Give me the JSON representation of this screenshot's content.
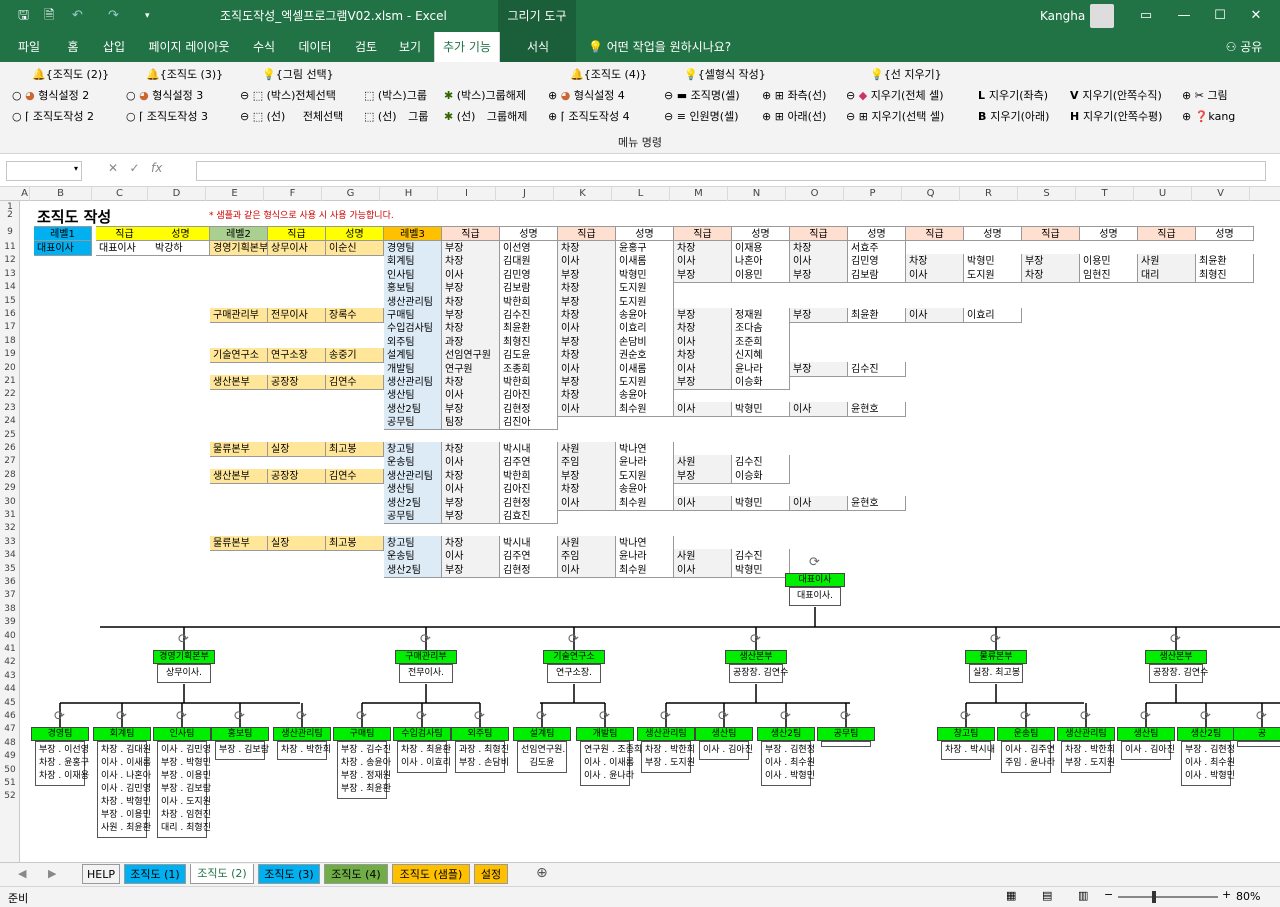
{
  "window": {
    "title": "조직도작성_엑셀프로그램V02.xlsm - Excel",
    "context_tool": "그리기 도구",
    "user": "Kangha"
  },
  "tabs": [
    "파일",
    "홈",
    "삽입",
    "페이지 레이아웃",
    "수식",
    "데이터",
    "검토",
    "보기",
    "추가 기능",
    "서식"
  ],
  "tell_me": "어떤 작업을 원하시나요?",
  "share": "공유",
  "ribbon": {
    "row1": [
      "{조직도 (2)}",
      "{조직도 (3)}",
      "{그림 선택}",
      "{조직도 (4)}",
      "{셀형식 작성}",
      "{선 지우기}"
    ],
    "row2": [
      "형식설정 2",
      "형식설정 3",
      "(박스)전체선택",
      "(박스)그룹",
      "(박스)그룹해제",
      "형식설정 4",
      "조직명(셀)",
      "좌측(선)",
      "지우기(전체 셀)",
      "지우기(좌측)",
      "지우기(안쪽수직)",
      "그림"
    ],
    "row3": [
      "조직도작성 2",
      "조직도작성 3",
      "(선)",
      "전체선택",
      "(선)",
      "그룹",
      "(선)",
      "그룹해제",
      "조직도작성 4",
      "인원명(셀)",
      "아래(선)",
      "지우기(선택 셀)",
      "지우기(아래)",
      "지우기(안쪽수평)",
      "kang"
    ],
    "group_label": "메뉴 명령"
  },
  "formula": {
    "fx": "fx",
    "value": ""
  },
  "columns": [
    "A",
    "B",
    "C",
    "D",
    "E",
    "F",
    "G",
    "H",
    "I",
    "J",
    "K",
    "L",
    "M",
    "N",
    "O",
    "P",
    "Q",
    "R",
    "S",
    "T",
    "U",
    "V"
  ],
  "rows": [
    "1",
    "2",
    "9",
    "11",
    "12",
    "13",
    "14",
    "15",
    "16",
    "17",
    "18",
    "19",
    "20",
    "21",
    "22",
    "23",
    "24",
    "25",
    "26",
    "27",
    "28",
    "29",
    "30",
    "31",
    "32",
    "33",
    "34",
    "35",
    "36",
    "37",
    "38",
    "39",
    "40",
    "41",
    "42",
    "43",
    "44",
    "45",
    "46",
    "47",
    "48",
    "49",
    "50",
    "51",
    "52"
  ],
  "sheet": {
    "title": "조직도 작성",
    "note": "* 샘플과 같은 형식으로 사용 시 사용 가능합니다.",
    "headers": [
      "레벨1",
      "직급",
      "성명",
      "레벨2",
      "직급",
      "성명",
      "레벨3",
      "직급",
      "성명",
      "직급",
      "성명",
      "직급",
      "성명",
      "직급",
      "성명",
      "직급",
      "성명",
      "직급",
      "성명",
      "직급",
      "성명"
    ],
    "level1": [
      "대표이사",
      "대표이사",
      "박강하"
    ],
    "level2": [
      {
        "row": 11,
        "v": [
          "경영기획본부",
          "상무이사",
          "이순신"
        ]
      },
      {
        "row": 16,
        "v": [
          "구매관리부",
          "전무이사",
          "장록수"
        ]
      },
      {
        "row": 19,
        "v": [
          "기술연구소",
          "연구소장",
          "송중기"
        ]
      },
      {
        "row": 21,
        "v": [
          "생산본부",
          "공장장",
          "김연수"
        ]
      },
      {
        "row": 26,
        "v": [
          "물류본부",
          "실장",
          "최고봉"
        ]
      },
      {
        "row": 28,
        "v": [
          "생산본부",
          "공장장",
          "김연수"
        ]
      },
      {
        "row": 33,
        "v": [
          "물류본부",
          "실장",
          "최고봉"
        ]
      }
    ],
    "level3": [
      {
        "row": 11,
        "v": [
          "경영팀",
          "부장",
          "이선영",
          "차장",
          "윤홍구",
          "차장",
          "이재용",
          "차장",
          "서효주"
        ]
      },
      {
        "row": 12,
        "v": [
          "회계팀",
          "차장",
          "김대원",
          "이사",
          "이새롬",
          "이사",
          "나혼아",
          "이사",
          "김민영",
          "차장",
          "박형민",
          "부장",
          "이용민",
          "사원",
          "최윤환"
        ]
      },
      {
        "row": 13,
        "v": [
          "인사팀",
          "이사",
          "김민영",
          "부장",
          "박형민",
          "부장",
          "이용민",
          "부장",
          "김보람",
          "이사",
          "도지원",
          "차장",
          "임현진",
          "대리",
          "최형진"
        ]
      },
      {
        "row": 14,
        "v": [
          "홍보팀",
          "부장",
          "김보람",
          "차장",
          "도지원"
        ]
      },
      {
        "row": 15,
        "v": [
          "생산관리팀",
          "차장",
          "박한희",
          "부장",
          "도지원"
        ]
      },
      {
        "row": 16,
        "v": [
          "구매팀",
          "부장",
          "김수진",
          "차장",
          "송윤아",
          "부장",
          "정재원",
          "부장",
          "최윤환",
          "이사",
          "이효리"
        ]
      },
      {
        "row": 17,
        "v": [
          "수입검사팀",
          "차장",
          "최윤환",
          "이사",
          "이효리",
          "차장",
          "조다솜"
        ]
      },
      {
        "row": 18,
        "v": [
          "외주팀",
          "과장",
          "최형진",
          "부장",
          "손담비",
          "이사",
          "조준희"
        ]
      },
      {
        "row": 19,
        "v": [
          "설계팀",
          "선임연구원",
          "김도윤",
          "차장",
          "권순호",
          "차장",
          "신지혜"
        ]
      },
      {
        "row": 20,
        "v": [
          "개발팀",
          "연구원",
          "조종희",
          "이사",
          "이새롬",
          "이사",
          "윤나라",
          "부장",
          "김수진"
        ]
      },
      {
        "row": 21,
        "v": [
          "생산관리팀",
          "차장",
          "박한희",
          "부장",
          "도지원",
          "부장",
          "이승화"
        ]
      },
      {
        "row": 22,
        "v": [
          "생산팀",
          "이사",
          "김아진",
          "차장",
          "송윤아"
        ]
      },
      {
        "row": 23,
        "v": [
          "생산2팀",
          "부장",
          "김현정",
          "이사",
          "최수원",
          "이사",
          "박형민",
          "이사",
          "윤현호"
        ]
      },
      {
        "row": 24,
        "v": [
          "공무팀",
          "팀장",
          "김진아"
        ]
      },
      {
        "row": 26,
        "v": [
          "창고팀",
          "차장",
          "박시내",
          "사원",
          "박나연"
        ]
      },
      {
        "row": 27,
        "v": [
          "운송팀",
          "이사",
          "김주연",
          "주임",
          "윤나라",
          "사원",
          "김수진"
        ]
      },
      {
        "row": 28,
        "v": [
          "생산관리팀",
          "차장",
          "박한희",
          "부장",
          "도지원",
          "부장",
          "이승화"
        ]
      },
      {
        "row": 29,
        "v": [
          "생산팀",
          "이사",
          "김아진",
          "차장",
          "송윤아"
        ]
      },
      {
        "row": 30,
        "v": [
          "생산2팀",
          "부장",
          "김현정",
          "이사",
          "최수원",
          "이사",
          "박형민",
          "이사",
          "윤현호"
        ]
      },
      {
        "row": 31,
        "v": [
          "공무팀",
          "부장",
          "김효진"
        ]
      },
      {
        "row": 33,
        "v": [
          "창고팀",
          "차장",
          "박시내",
          "사원",
          "박나연"
        ]
      },
      {
        "row": 34,
        "v": [
          "운송팀",
          "이사",
          "김주연",
          "주임",
          "윤나라",
          "사원",
          "김수진"
        ]
      },
      {
        "row": 35,
        "v": [
          "생산2팀",
          "부장",
          "김현정",
          "이사",
          "최수원",
          "이사",
          "박형민"
        ]
      }
    ]
  },
  "chart": {
    "top": {
      "name": "대표이사",
      "sub": "대표이사."
    },
    "l2": [
      {
        "name": "경영기획본부",
        "sub": "상무이사."
      },
      {
        "name": "구매관리부",
        "sub": "전무이사."
      },
      {
        "name": "기술연구소",
        "sub": "연구소장."
      },
      {
        "name": "생산본부",
        "sub": "공장장. 김연수"
      },
      {
        "name": "물류본부",
        "sub": "실장. 최고봉"
      },
      {
        "name": "생산본부",
        "sub": "공장장. 김연수"
      }
    ],
    "l3": [
      {
        "name": "경영팀",
        "sub": "부장 . 이선영\n차장 . 윤홍구\n차장 . 이재용"
      },
      {
        "name": "회계팀",
        "sub": "차장 . 김대원\n이사 . 이새롬\n이사 . 나혼아\n이사 . 김민영\n차장 . 박형민\n부장 . 이용민\n사원 . 최윤환"
      },
      {
        "name": "인사팀",
        "sub": "이사 . 김민영\n부장 . 박형민\n부장 . 이용민\n부장 . 김보람\n이사 . 도지원\n차장 . 임현진\n대리 . 최형진"
      },
      {
        "name": "홍보팀",
        "sub": "부장 . 김보람"
      },
      {
        "name": "생산관리팀",
        "sub": "차장 . 박한희"
      },
      {
        "name": "구매팀",
        "sub": "부장 . 김수진\n차장 . 송윤아\n부장 . 정재원\n부장 . 최윤환"
      },
      {
        "name": "수입검사팀",
        "sub": "차장 . 최윤환\n이사 . 이효리"
      },
      {
        "name": "외주팀",
        "sub": "과장 . 최형진\n부장 . 손담비"
      },
      {
        "name": "설계팀",
        "sub": "선임연구원.\n김도윤"
      },
      {
        "name": "개발팀",
        "sub": "연구원 . 조종희\n이사 . 이새롬\n이사 . 윤나라"
      },
      {
        "name": "생산관리팀",
        "sub": "차장 . 박한희\n부장 . 도지원"
      },
      {
        "name": "생산팀",
        "sub": "이사 . 김아진"
      },
      {
        "name": "생산2팀",
        "sub": "부장 . 김현정\n이사 . 최수원\n이사 . 박형민"
      },
      {
        "name": "공무팀",
        "sub": ""
      },
      {
        "name": "창고팀",
        "sub": "차장 . 박시내"
      },
      {
        "name": "운송팀",
        "sub": "이사 . 김주연\n주임 . 윤나라"
      },
      {
        "name": "생산관리팀",
        "sub": "차장 . 박한희\n부장 . 도지원"
      },
      {
        "name": "생산팀",
        "sub": "이사 . 김아진"
      },
      {
        "name": "생산2팀",
        "sub": "부장 . 김현정\n이사 . 최수원\n이사 . 박형민"
      },
      {
        "name": "공",
        "sub": ""
      }
    ]
  },
  "sheet_tabs": [
    {
      "label": "HELP",
      "color": "#f3f3f3"
    },
    {
      "label": "조직도 (1)",
      "color": "#00b0f0"
    },
    {
      "label": "조직도 (2)",
      "color": "#ffffff"
    },
    {
      "label": "조직도 (3)",
      "color": "#00b0f0"
    },
    {
      "label": "조직도 (4)",
      "color": "#70ad47"
    },
    {
      "label": "조직도 (샘플)",
      "color": "#ffc000"
    },
    {
      "label": "설정",
      "color": "#ffc000"
    }
  ],
  "status": {
    "ready": "준비",
    "zoom": "80%"
  }
}
